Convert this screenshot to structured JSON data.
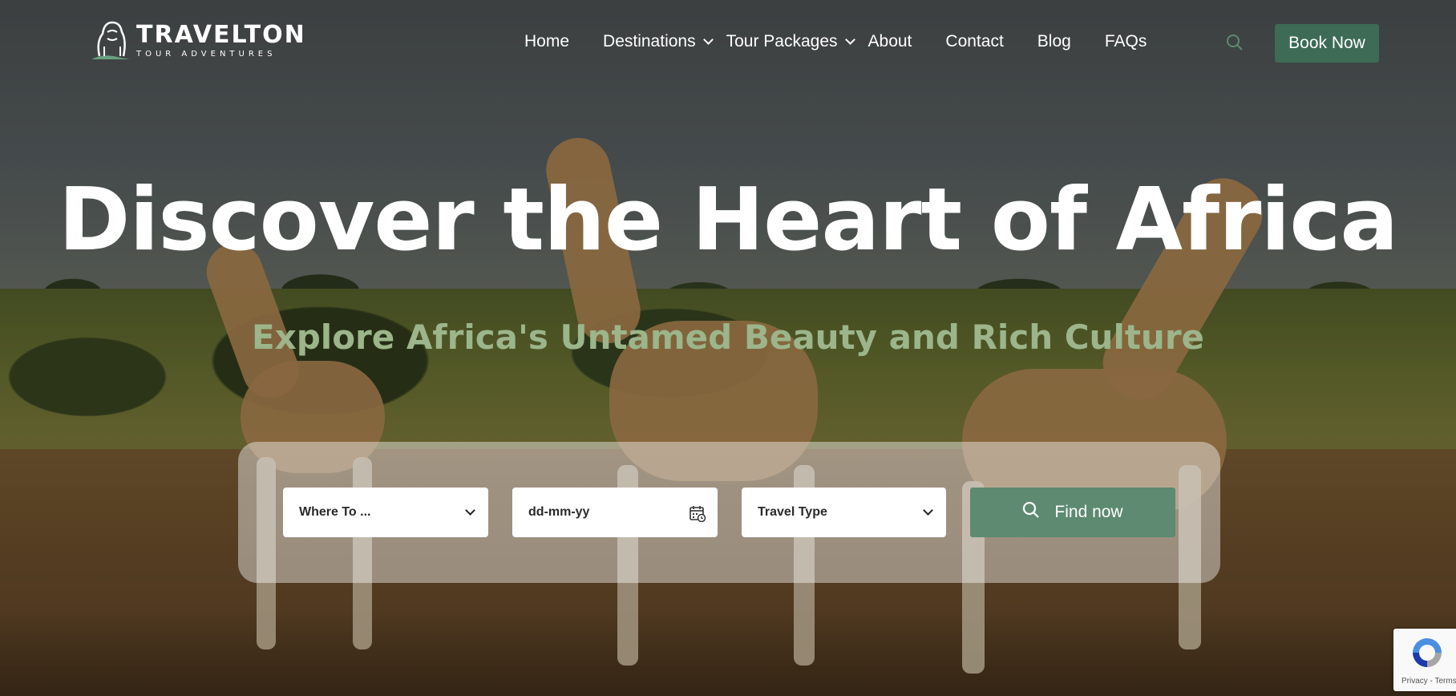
{
  "brand": {
    "name": "TRAVELTON",
    "tagline": "TOUR ADVENTURES"
  },
  "nav": {
    "items": [
      {
        "label": "Home",
        "has_dropdown": false
      },
      {
        "label": "Destinations",
        "has_dropdown": true
      },
      {
        "label": "Tour Packages",
        "has_dropdown": true
      },
      {
        "label": "About",
        "has_dropdown": false
      },
      {
        "label": "Contact",
        "has_dropdown": false
      },
      {
        "label": "Blog",
        "has_dropdown": false
      },
      {
        "label": "FAQs",
        "has_dropdown": false
      }
    ],
    "search_icon": "search-icon",
    "cta_label": "Book Now"
  },
  "hero": {
    "title": "Discover the Heart of Africa",
    "subtitle": "Explore Africa's Untamed Beauty and Rich Culture"
  },
  "search_form": {
    "destination": {
      "selected": "Where To ..."
    },
    "date": {
      "value": "dd-mm-yy",
      "icon": "calendar-icon"
    },
    "travel_type": {
      "selected": "Travel Type"
    },
    "submit_label": "Find now"
  },
  "recaptcha": {
    "links": "Privacy - Terms"
  },
  "colors": {
    "accent": "#3d6b56",
    "button": "#5d8a70",
    "subtitle": "#9cb58a"
  }
}
